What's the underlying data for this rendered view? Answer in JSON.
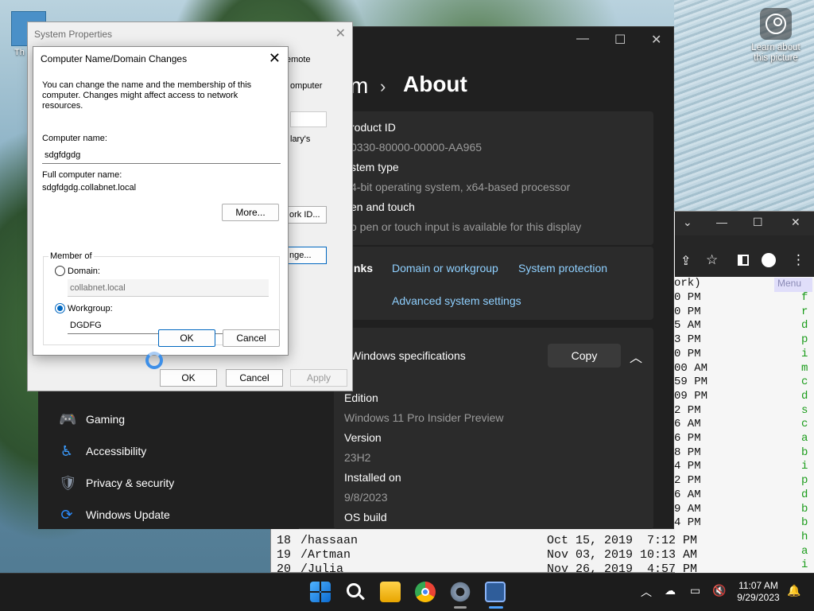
{
  "desktop": {
    "icon_label_fragment": "Th",
    "learn_label": "Learn about this picture"
  },
  "terminal": {
    "header_fragment": "ork)",
    "menu_label": "Menu",
    "time_fragments": [
      "0 PM",
      "0 PM",
      "5 AM",
      "3 PM",
      "0 PM",
      "00 AM",
      "59 PM",
      "09 PM",
      "2 PM",
      "6 AM",
      "6 PM",
      "8 PM",
      "4 PM",
      "2 PM",
      "6 AM",
      "9 AM",
      "4 PM"
    ],
    "green_fragments": [
      "f",
      "r",
      "d",
      "p",
      "i",
      "m",
      "c",
      "d",
      "s",
      "c",
      "a",
      "b",
      "i",
      "p",
      "d",
      "b",
      "b",
      "h",
      "a",
      "i"
    ],
    "rows": [
      {
        "num": "18",
        "name": "/hassaan",
        "date": "Oct 15, 2019  7:12 PM"
      },
      {
        "num": "19",
        "name": "/Artman",
        "date": "Nov 03, 2019 10:13 AM"
      },
      {
        "num": "20",
        "name": "/Julia",
        "date": "Nov 26, 2019  4:57 PM"
      }
    ]
  },
  "settings": {
    "breadcrumb_prefix": "m",
    "breadcrumb_separator": "›",
    "page_title": "About",
    "product_id_label": "roduct ID",
    "product_id_value": "0330-80000-00000-AA965",
    "system_type_label": "stem type",
    "system_type_value": "4-bit operating system, x64-based processor",
    "pen_label": "en and touch",
    "pen_value": "o pen or touch input is available for this display",
    "links_label": "inks",
    "links": [
      "Domain or workgroup",
      "System protection",
      "Advanced system settings"
    ],
    "winspec_title": "Windows specifications",
    "copy_label": "Copy",
    "specs": [
      {
        "label": "Edition",
        "value": "Windows 11 Pro Insider Preview"
      },
      {
        "label": "Version",
        "value": "23H2"
      },
      {
        "label": "Installed on",
        "value": "9/8/2023"
      },
      {
        "label": "OS build",
        "value": ""
      }
    ],
    "nav": [
      {
        "label": "Gaming",
        "icon": "gamepad-icon"
      },
      {
        "label": "Accessibility",
        "icon": "accessibility-icon"
      },
      {
        "label": "Privacy & security",
        "icon": "shield-icon"
      },
      {
        "label": "Windows Update",
        "icon": "windows-update-icon"
      }
    ]
  },
  "system_properties": {
    "title": "System Properties",
    "tab_fragment": "emote",
    "computer_fragment": "omputer",
    "primary_fragment": "lary's",
    "network_id_fragment": "ork ID...",
    "change_fragment": "nge...",
    "ok_label": "OK",
    "cancel_label": "Cancel",
    "apply_label": "Apply"
  },
  "dialog": {
    "title": "Computer Name/Domain Changes",
    "description": "You can change the name and the membership of this computer. Changes might affect access to network resources.",
    "computer_name_label": "Computer name:",
    "computer_name_value": "sdgfdgdg",
    "full_name_label": "Full computer name:",
    "full_name_value": "sdgfdgdg.collabnet.local",
    "more_label": "More...",
    "member_of_label": "Member of",
    "domain_label": "Domain:",
    "domain_value": "collabnet.local",
    "workgroup_label": "Workgroup:",
    "workgroup_value": "DGDFG",
    "selected_option": "Workgroup",
    "ok_label": "OK",
    "cancel_label": "Cancel"
  },
  "taskbar": {
    "apps": [
      "start-icon",
      "search-icon",
      "file-explorer-icon",
      "chrome-icon",
      "settings-icon",
      "remote-desktop-icon"
    ],
    "time": "11:07 AM",
    "date": "9/29/2023"
  },
  "colors": {
    "settings_bg": "#202020",
    "settings_card": "#2b2b2b",
    "link": "#8fd0ff",
    "accent": "#0067c0",
    "taskbar": "#1c1c1c"
  }
}
